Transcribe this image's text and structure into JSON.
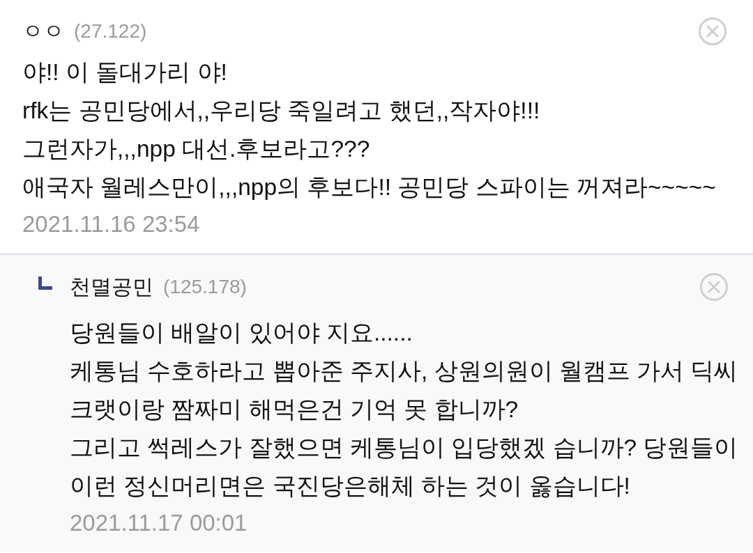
{
  "comments": [
    {
      "author": "ㅇㅇ",
      "ip": "(27.122)",
      "body": [
        "야!! 이 돌대가리 야!",
        "rfk는 공민당에서,,우리당 죽일려고 했던,,작자야!!!",
        "그런자가,,,npp 대선.후보라고???",
        "애국자 월레스만이,,,npp의 후보다!! 공민당 스파이는 꺼져라~~~~~"
      ],
      "date": "2021.11.16 23:54",
      "replies": [
        {
          "author": "천멸공민",
          "ip": "(125.178)",
          "body": [
            "당원들이 배알이 있어야 지요......",
            "케통님 수호하라고 뽑아준 주지사, 상원의원이 월캠프 가서 딕씨",
            "크랫이랑 짬짜미 해먹은건 기억 못 합니까?",
            "그리고 썩레스가 잘했으면 케통님이 입당했겠 습니까? 당원들이",
            "이런 정신머리면은 국진당은해체 하는 것이 옳습니다!"
          ],
          "date": "2021.11.17 00:01"
        }
      ]
    }
  ]
}
